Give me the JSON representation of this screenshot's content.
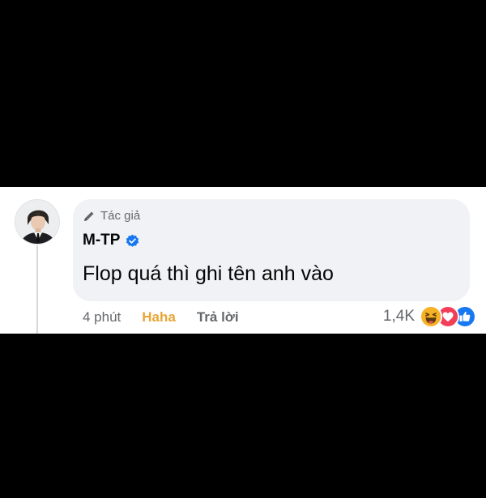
{
  "comment": {
    "author_badge": "Tác giả",
    "author_badge_icon": "pencil-icon",
    "author_name": "M-TP",
    "verified_icon": "verified-check-icon",
    "text": "Flop quá thì ghi tên anh vào"
  },
  "actions": {
    "time": "4 phút",
    "reaction_label": "Haha",
    "reply": "Trả lời"
  },
  "reactions": {
    "count": "1,4K",
    "icons": [
      "haha-icon",
      "love-icon",
      "like-icon"
    ]
  },
  "colors": {
    "background": "#000000",
    "card": "#ffffff",
    "bubble": "#f0f2f5",
    "haha": "#e8a534",
    "verified": "#1877f2",
    "love": "#f33e58",
    "like": "#1877f2"
  }
}
